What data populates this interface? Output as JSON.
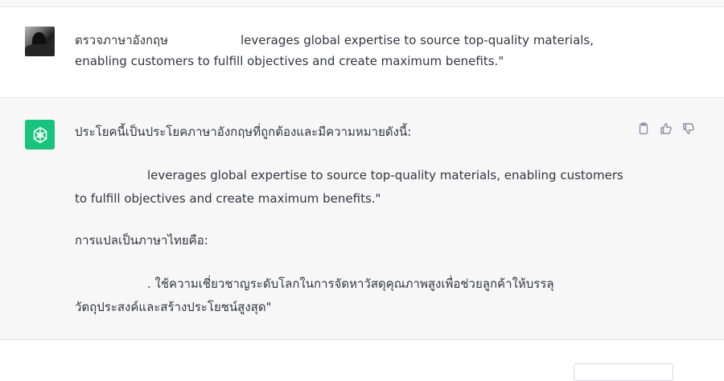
{
  "conversation": {
    "user_message": {
      "prefix": "ตรวจภาษาอังกฤษ",
      "rest": "leverages global expertise to source top-quality materials, enabling customers to fulfill objectives and create maximum benefits.\""
    },
    "assistant_message": {
      "intro": "ประโยคนี้เป็นประโยคภาษาอังกฤษที่ถูกต้องและมีความหมายดังนี้:",
      "english_line1": "leverages global expertise to source top-quality materials, enabling customers",
      "english_line2": "to fulfill objectives and create maximum benefits.\"",
      "translation_label": "การแปลเป็นภาษาไทยคือ:",
      "thai_line1": ". ใช้ความเชี่ยวชาญระดับโลกในการจัดหาวัสดุคุณภาพสูงเพื่อช่วยลูกค้าให้บรรลุ",
      "thai_line2": "วัตถุประสงค์และสร้างประโยชน์สูงสุด\""
    },
    "actions": {
      "copy_icon": "clipboard-icon",
      "like_icon": "thumbs-up-icon",
      "dislike_icon": "thumbs-down-icon"
    }
  },
  "colors": {
    "brand": "#19c37d",
    "assistant_bg": "#f7f7f8",
    "text": "#343541"
  }
}
